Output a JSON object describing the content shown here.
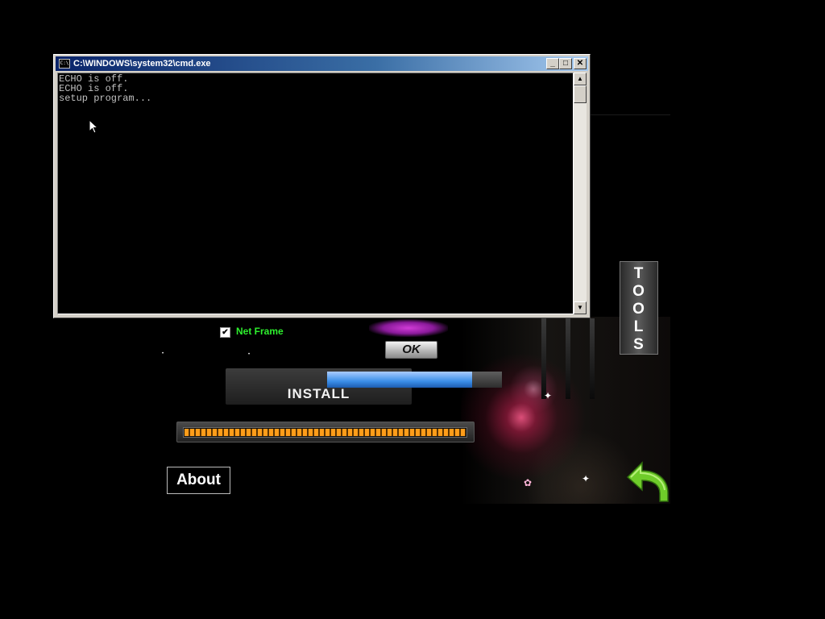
{
  "cmd_window": {
    "title": "C:\\WINDOWS\\system32\\cmd.exe",
    "icon_text": "C:\\",
    "minimize_glyph": "_",
    "maximize_glyph": "□",
    "close_glyph": "✕",
    "console_lines": [
      "ECHO is off.",
      "ECHO is off.",
      "setup program..."
    ],
    "scroll_up_glyph": "▲",
    "scroll_down_glyph": "▼"
  },
  "installer": {
    "tools_letters": [
      "T",
      "O",
      "O",
      "L",
      "S"
    ],
    "net_frame_label": "Net Frame",
    "net_frame_checked": true,
    "check_glyph": "✔",
    "ok_label": "OK",
    "install_label": "INSTALL",
    "blue_progress_fraction": 0.83,
    "orange_progress_fraction": 1.0,
    "about_label": "About",
    "accent_orange": "#ff9d1a",
    "accent_green": "#2ef02e",
    "back_arrow_color": "#6fcc2a"
  }
}
